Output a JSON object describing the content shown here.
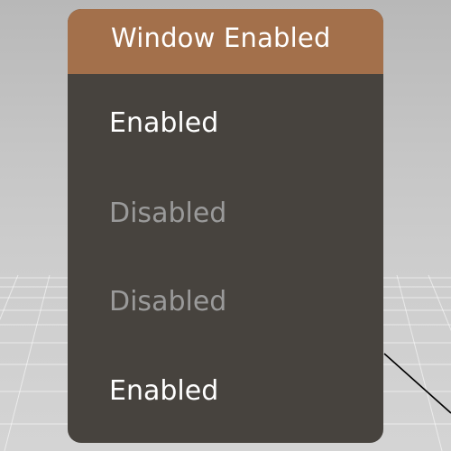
{
  "window": {
    "title": "Window Enabled",
    "title_color": "#ffffff",
    "header_color": "#a3704b",
    "body_color": "#47433e"
  },
  "menu": {
    "items": [
      {
        "label": "Enabled",
        "state": "enabled"
      },
      {
        "label": "Disabled",
        "state": "disabled"
      },
      {
        "label": "Disabled",
        "state": "disabled"
      },
      {
        "label": "Enabled",
        "state": "enabled"
      }
    ]
  }
}
